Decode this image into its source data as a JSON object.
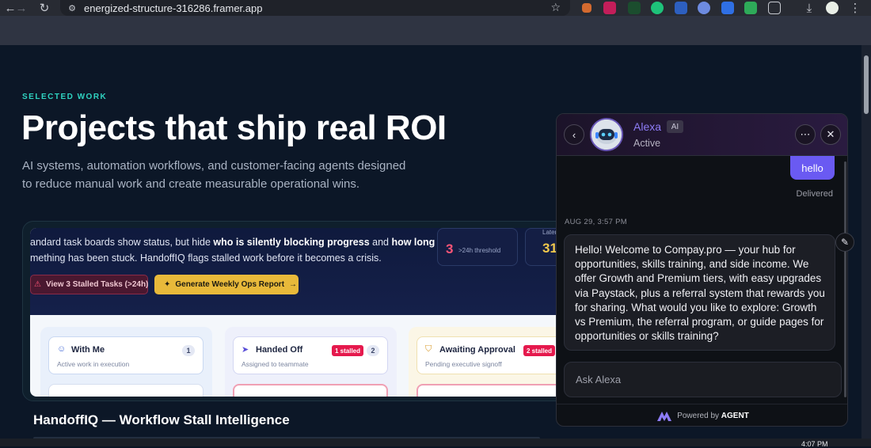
{
  "browser": {
    "url": "energized-structure-316286.framer.app"
  },
  "page": {
    "eyebrow": "SELECTED WORK",
    "headline": "Projects that ship real ROI",
    "subtext": "AI systems, automation workflows, and customer-facing agents designed to reduce manual work and create measurable operational wins.",
    "project": {
      "description_pre": "andard task boards show status, but hide ",
      "description_bold1": "who is silently blocking progress",
      "description_mid": " and ",
      "description_bold2": "how long",
      "description_line2_pre": "mething has been stuck.",
      "description_line2": " HandoffIQ flags stalled work before it becomes a crisis.",
      "btn_stalled": "View 3 Stalled Tasks (>24h)",
      "btn_report": "Generate Weekly Ops Report",
      "metric1_value": "3",
      "metric1_label": ">24h threshold",
      "metric2_label": "Latenc",
      "metric2_value": "31h",
      "columns": [
        {
          "title": "With Me",
          "subtitle": "Active work in execution",
          "count": "1",
          "badge": ""
        },
        {
          "title": "Handed Off",
          "subtitle": "Assigned to teammate",
          "count": "2",
          "badge": "1 stalled"
        },
        {
          "title": "Awaiting Approval",
          "subtitle": "Pending executive signoff",
          "count": "",
          "badge": "2 stalled"
        }
      ],
      "title": "HandoffIQ — Workflow Stall Intelligence"
    }
  },
  "chat": {
    "agent_name": "Alexa",
    "ai_tag": "AI",
    "status": "Active",
    "user_message": "hello",
    "delivered": "Delivered",
    "timestamp": "AUG 29, 3:57 PM",
    "bot_message": "Hello! Welcome to Compay.pro — your hub for opportunities, skills training, and side income. We offer Growth and Premium tiers, with easy upgrades via Paystack, plus a referral system that rewards you for sharing. What would you like to explore: Growth vs Premium, the referral program, or guide pages for opportunities or skills training?",
    "input_placeholder": "Ask Alexa",
    "powered_by": "Powered by",
    "powered_brand": "AGENT"
  },
  "taskbar": {
    "clock": "4:07 PM"
  },
  "colors": {
    "accent": "#6a5af2",
    "eyebrow": "#2fd3c1",
    "stalled": "#e5194d",
    "report_button": "#e8b93a"
  }
}
